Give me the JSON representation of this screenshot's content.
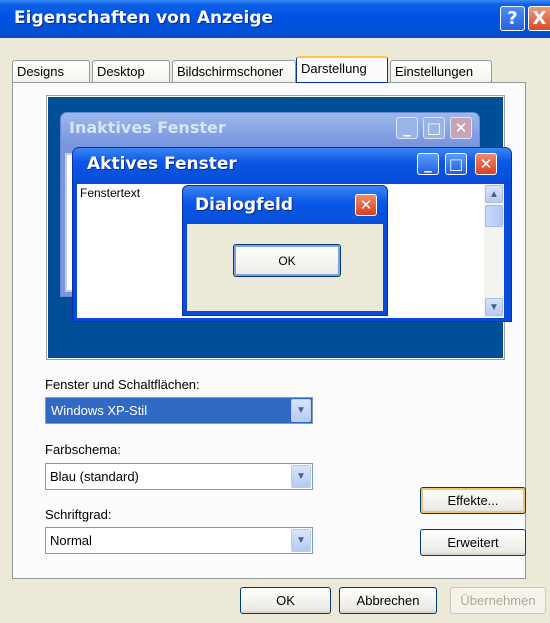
{
  "window": {
    "title": "Eigenschaften von Anzeige",
    "help_label": "?",
    "close_label": "X"
  },
  "tabs": [
    {
      "label": "Designs"
    },
    {
      "label": "Desktop"
    },
    {
      "label": "Bildschirmschoner"
    },
    {
      "label": "Darstellung"
    },
    {
      "label": "Einstellungen"
    }
  ],
  "active_tab": "Darstellung",
  "preview": {
    "inactive_title": "Inaktives Fenster",
    "active_title": "Aktives Fenster",
    "window_text": "Fenstertext",
    "dialog_title": "Dialogfeld",
    "dialog_ok": "OK",
    "minimize_glyph": "_",
    "maximize_glyph": "□",
    "close_glyph": "✕",
    "scroll_up_glyph": "▲",
    "scroll_down_glyph": "▼"
  },
  "settings": {
    "windows_buttons_label": "Fenster und Schaltflächen:",
    "windows_buttons_value": "Windows XP-Stil",
    "color_scheme_label": "Farbschema:",
    "color_scheme_value": "Blau (standard)",
    "font_size_label": "Schriftgrad:",
    "font_size_value": "Normal",
    "dropdown_glyph": "▼"
  },
  "buttons": {
    "effects": "Effekte...",
    "advanced": "Erweitert",
    "ok": "OK",
    "cancel": "Abbrechen",
    "apply": "Übernehmen"
  },
  "colors": {
    "titlebar": "#0054e3",
    "desktop_preview": "#004e98",
    "selection": "#316ac5",
    "tab_highlight": "#ffc83c"
  }
}
